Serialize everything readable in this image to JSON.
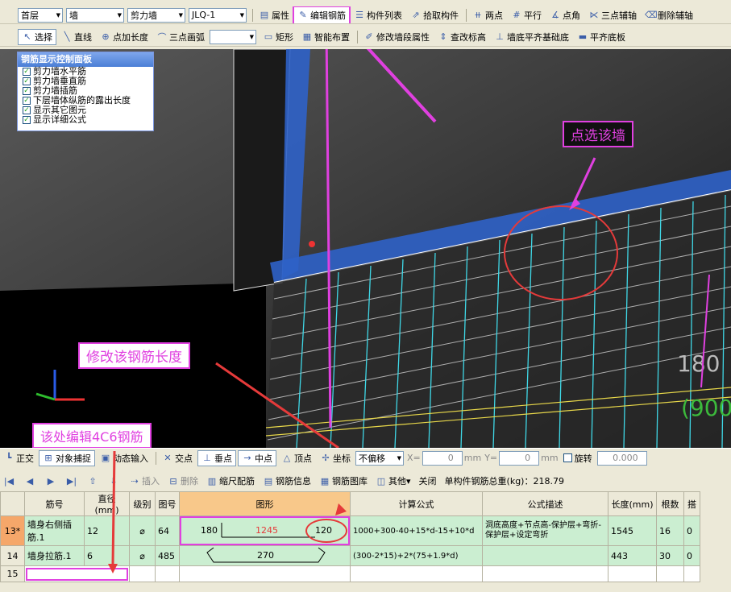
{
  "toolbar1": {
    "floor": "首层",
    "category": "墙",
    "type": "剪力墙",
    "element": "JLQ-1",
    "properties": "属性",
    "edit_rebar": "编辑钢筋",
    "element_list": "构件列表",
    "pick_element": "拾取构件",
    "two_points": "两点",
    "parallel": "平行",
    "point_angle": "点角",
    "three_point_axis": "三点辅轴",
    "delete_axis": "删除辅轴"
  },
  "toolbar2": {
    "select": "选择",
    "line": "直线",
    "point_length": "点加长度",
    "arc": "三点画弧",
    "rect": "矩形",
    "smart_layout": "智能布置",
    "modify_segment": "修改墙段属性",
    "check_elevation": "查改标高",
    "align_foundation": "墙底平齐基础底",
    "align_slab": "平齐底板"
  },
  "panel": {
    "title": "钢筋显示控制面板",
    "items": [
      "剪力墙水平筋",
      "剪力墙垂直筋",
      "剪力墙插筋",
      "下层墙体纵筋的露出长度",
      "显示其它图元",
      "显示详细公式"
    ]
  },
  "annotations": {
    "pick_wall": "点选该墙",
    "modify_length": "修改该钢筋长度",
    "edit_4c6": "该处编辑4C6钢筋"
  },
  "view_labels": {
    "dim1": "180",
    "dim2": "(900"
  },
  "snapbar": {
    "ortho": "正交",
    "obj_snap": "对象捕捉",
    "dyn_input": "动态输入",
    "intersection": "交点",
    "perpendicular": "垂点",
    "midpoint": "中点",
    "vertex": "顶点",
    "coordinate": "坐标",
    "offset_mode": "不偏移",
    "x_label": "X=",
    "x_value": "0",
    "y_label": "Y=",
    "y_value": "0",
    "unit": "mm",
    "rotate": "旋转",
    "rotate_value": "0.000"
  },
  "gridbar": {
    "insert": "插入",
    "delete": "删除",
    "scale_rebar": "缩尺配筋",
    "rebar_info": "钢筋信息",
    "rebar_library": "钢筋图库",
    "other": "其他",
    "close": "关闭",
    "total_weight": "单构件钢筋总重(kg)：218.79"
  },
  "table": {
    "headers": [
      "筋号",
      "直径(mm)",
      "级别",
      "图号",
      "图形",
      "计算公式",
      "公式描述",
      "长度(mm)",
      "根数",
      "搭"
    ],
    "rows": [
      {
        "no": "13*",
        "name": "墙身右侧插筋.1",
        "dia": "12",
        "grade": "⌀",
        "fig": "64",
        "shape_left": "180",
        "shape_mid": "1245",
        "shape_right": "120",
        "formula": "1000+300-40+15*d-15+10*d",
        "desc": "洞底高度+节点高-保护层+弯折-保护层+设定弯折",
        "length": "1545",
        "count": "16",
        "lap": "0"
      },
      {
        "no": "14",
        "name": "墙身拉筋.1",
        "dia": "6",
        "grade": "⌀",
        "fig": "485",
        "shape_mid": "270",
        "formula": "(300-2*15)+2*(75+1.9*d)",
        "desc": "",
        "length": "443",
        "count": "30",
        "lap": "0"
      },
      {
        "no": "15",
        "name": "",
        "dia": "",
        "grade": "",
        "fig": "",
        "formula": "",
        "desc": "",
        "length": "",
        "count": "",
        "lap": ""
      }
    ]
  }
}
